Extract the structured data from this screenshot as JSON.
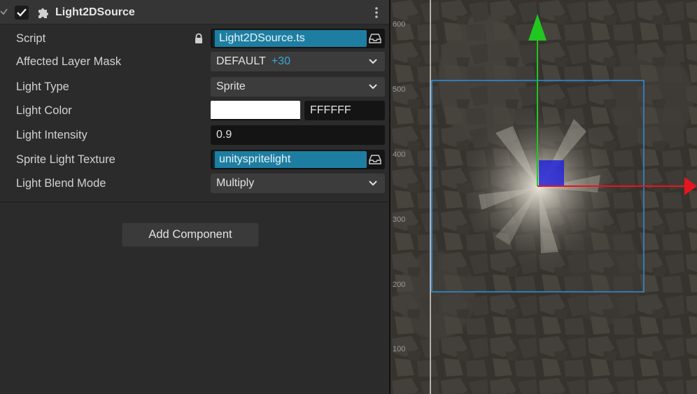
{
  "component": {
    "title": "Light2DSource",
    "enabled": true,
    "icons": {
      "caret": "chevron-down-icon",
      "component": "puzzle-piece-icon",
      "more": "more-vertical-icon"
    }
  },
  "properties": {
    "script": {
      "label": "Script",
      "value": "Light2DSource.ts"
    },
    "layer_mask": {
      "label": "Affected Layer Mask",
      "value": "DEFAULT",
      "extra": "+30"
    },
    "light_type": {
      "label": "Light Type",
      "value": "Sprite"
    },
    "light_color": {
      "label": "Light Color",
      "swatch": "#FFFFFF",
      "hex": "FFFFFF"
    },
    "light_intensity": {
      "label": "Light Intensity",
      "value": "0.9"
    },
    "sprite_texture": {
      "label": "Sprite Light Texture",
      "value": "unityspritelight"
    },
    "blend_mode": {
      "label": "Light Blend Mode",
      "value": "Multiply"
    }
  },
  "add_component": {
    "label": "Add Component"
  },
  "scene": {
    "ruler_labels": [
      "600",
      "500",
      "400",
      "300",
      "200",
      "100"
    ],
    "colors": {
      "x_axis": "#e8141e",
      "y_axis": "#21c621",
      "selection": "#2b8fdc",
      "center_handle": "#2424d8"
    }
  }
}
